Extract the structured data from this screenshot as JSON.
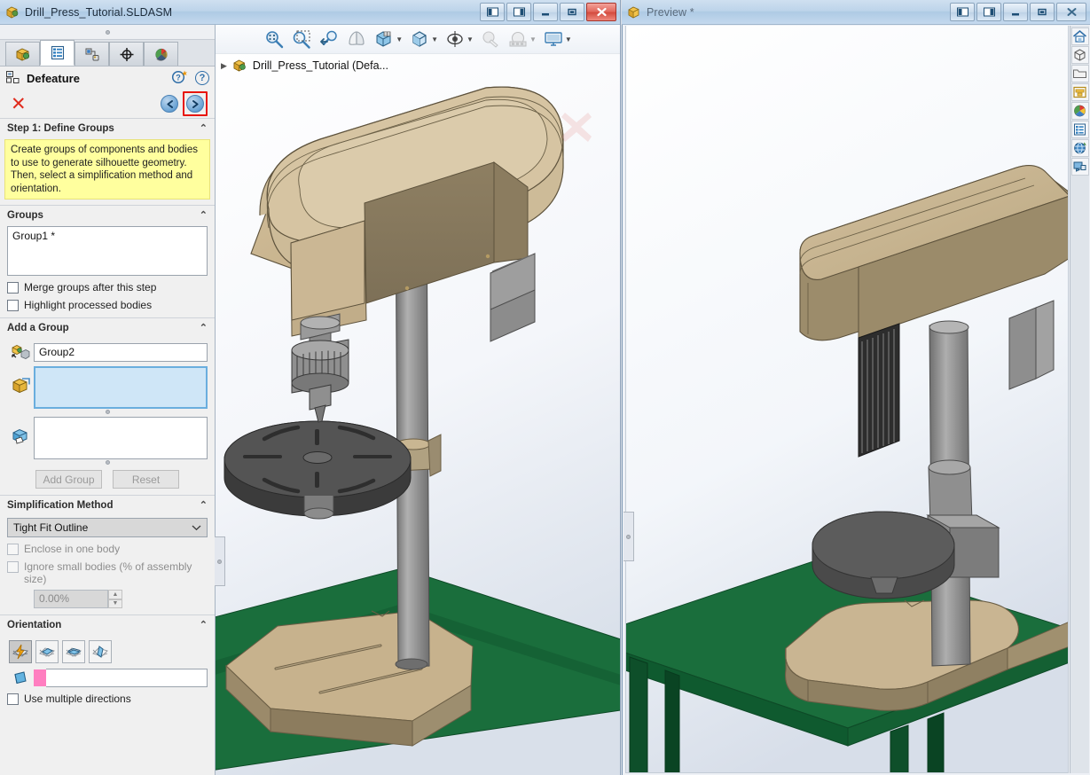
{
  "left_window": {
    "title": "Drill_Press_Tutorial.SLDASM",
    "logo_icon": "solidworks-assembly-icon",
    "window_buttons": [
      {
        "name": "restore-left-pane-button",
        "glyph": "◧"
      },
      {
        "name": "restore-right-pane-button",
        "glyph": "◨"
      },
      {
        "name": "minimize-button",
        "glyph": "—"
      },
      {
        "name": "maximize-button",
        "glyph": "❐"
      },
      {
        "name": "close-button",
        "glyph": "✕"
      }
    ]
  },
  "property_manager": {
    "tabs": [
      {
        "name": "feature-manager-tab",
        "icon": "assembly-tree-icon",
        "active": false
      },
      {
        "name": "property-manager-tab",
        "icon": "property-list-icon",
        "active": true
      },
      {
        "name": "configuration-manager-tab",
        "icon": "configuration-icon",
        "active": false
      },
      {
        "name": "dimxpert-manager-tab",
        "icon": "crosshair-icon",
        "active": false
      },
      {
        "name": "display-manager-tab",
        "icon": "color-sphere-icon",
        "active": false
      }
    ],
    "header": {
      "title": "Defeature",
      "icon": "defeature-icon",
      "whats_new_icon": "help-star-icon",
      "help_icon": "help-question-icon"
    },
    "actions": {
      "cancel_glyph": "✕",
      "back_glyph": "←",
      "next_glyph": "→",
      "next_highlighted": true
    },
    "step": {
      "heading": "Step 1: Define Groups",
      "callout": "Create groups of components and bodies to use to generate silhouette geometry. Then, select a simplification method and orientation."
    },
    "groups": {
      "heading": "Groups",
      "items": [
        "Group1 *"
      ],
      "merge_checkbox_label": "Merge groups after this step",
      "merge_checked": false,
      "highlight_checkbox_label": "Highlight processed bodies",
      "highlight_checked": false
    },
    "add_group": {
      "heading": "Add a Group",
      "name_icon": "group-name-icon",
      "name_value": "Group2",
      "components_icon": "component-box-icon",
      "components_value": "",
      "bodies_icon": "body-icon",
      "bodies_value": "",
      "add_button_label": "Add Group",
      "reset_button_label": "Reset",
      "buttons_disabled": true
    },
    "simplification": {
      "heading": "Simplification Method",
      "method_value": "Tight Fit Outline",
      "enclose_label": "Enclose in one body",
      "enclose_checked": false,
      "ignore_label": "Ignore small bodies (% of assembly size)",
      "ignore_checked": false,
      "percent_value": "0.00%"
    },
    "orientation": {
      "heading": "Orientation",
      "buttons": [
        {
          "name": "orientation-auto-button",
          "icon": "auto-orient-icon",
          "selected": true
        },
        {
          "name": "orientation-single-button",
          "icon": "single-plane-icon",
          "selected": false
        },
        {
          "name": "orientation-dual-button",
          "icon": "dual-plane-icon",
          "selected": false
        },
        {
          "name": "orientation-triple-button",
          "icon": "triple-plane-icon",
          "selected": false
        }
      ],
      "plane_icon": "plane-icon",
      "plane_selection_value": "",
      "multi_dir_label": "Use multiple directions",
      "multi_dir_checked": false
    }
  },
  "view_toolbar": {
    "tools": [
      {
        "name": "zoom-to-fit-icon",
        "label": "Zoom to Fit"
      },
      {
        "name": "zoom-to-area-icon",
        "label": "Zoom to Area"
      },
      {
        "name": "previous-view-icon",
        "label": "Previous View"
      },
      {
        "name": "section-view-icon",
        "label": "Section View"
      },
      {
        "name": "view-orientation-icon",
        "label": "View Orientation",
        "has_caret": true
      },
      {
        "name": "display-style-icon",
        "label": "Display Style",
        "has_caret": true
      },
      {
        "name": "hide-show-items-icon",
        "label": "Hide/Show Items",
        "has_caret": true
      },
      {
        "name": "edit-appearance-icon",
        "label": "Edit Appearance",
        "has_caret": true
      },
      {
        "name": "apply-scene-icon",
        "label": "Apply Scene",
        "has_caret": true
      },
      {
        "name": "view-settings-icon",
        "label": "View Settings",
        "has_caret": true
      }
    ]
  },
  "feature_tree": {
    "expand_glyph": "▶",
    "icon": "assembly-icon",
    "label": "Drill_Press_Tutorial  (Defa..."
  },
  "graphics": {
    "overlay_x_icon": "cancel-x-overlay",
    "splitter_handle_icon": "splitter-dot"
  },
  "preview_window": {
    "title": "Preview *",
    "logo_icon": "solidworks-part-icon",
    "window_buttons": [
      {
        "name": "preview-restore-left-button",
        "glyph": "◧"
      },
      {
        "name": "preview-restore-right-button",
        "glyph": "◨"
      },
      {
        "name": "preview-minimize-button",
        "glyph": "—"
      },
      {
        "name": "preview-maximize-button",
        "glyph": "❐"
      },
      {
        "name": "preview-close-button",
        "glyph": "✕"
      }
    ],
    "rail_icons": [
      {
        "name": "home-icon"
      },
      {
        "name": "parts-icon"
      },
      {
        "name": "folder-icon"
      },
      {
        "name": "library-feature-icon"
      },
      {
        "name": "appearances-icon"
      },
      {
        "name": "custom-properties-icon"
      },
      {
        "name": "3d-content-central-icon"
      },
      {
        "name": "view-palette-icon"
      }
    ]
  },
  "colors": {
    "accent_blue": "#2f6ea8",
    "highlight_red": "#e8160c",
    "selection_blue": "#cfe6f7",
    "callout_yellow": "#ffff9e",
    "model_tan": "#c4ae86",
    "model_gray": "#8a8a8a",
    "model_dark_gray": "#545454",
    "table_green": "#16703a",
    "pink_chip": "#ff7ec0"
  }
}
